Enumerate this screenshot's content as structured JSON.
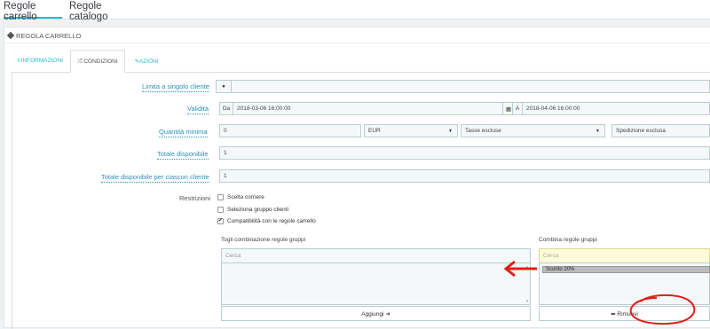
{
  "topnav": {
    "tab_cart_rules": "Regole carrello",
    "tab_catalog_rules": "Regole catalogo"
  },
  "panel": {
    "title": "REGOLA CARRELLO"
  },
  "tabs": {
    "info": "INFORMAZIONI",
    "conditions": "CONDIZIONI",
    "actions": "AZIONI"
  },
  "form": {
    "limit_customer_label": "Limita a singolo cliente",
    "validity_label": "Validità",
    "from_label": "Da",
    "from_value": "2018-03-06 16:00:00",
    "to_label": "A",
    "to_value": "2018-04-06 16:00:00",
    "min_qty_label": "Quantità minima",
    "min_qty_value": "0",
    "currency_value": "EUR",
    "tax_value": "Tasse escluse",
    "shipping_value": "Spedizione esclusa",
    "total_available_label": "Totale disponibile",
    "total_available_value": "1",
    "per_customer_label": "Totale disponibile per ciascun cliente",
    "per_customer_value": "1",
    "restrictions_label": "Restrizioni",
    "restriction_carrier": "Scelta corriere",
    "restriction_group": "Seleziona gruppo clienti",
    "restriction_compat": "Compatibilità con le regole carrello",
    "remove_combo_label": "Togli combinazione regole gruppi",
    "combine_label": "Combina regole gruppi",
    "search_placeholder": "Cerca",
    "search_value": "Cerca",
    "selected_option": "Sconto 20%",
    "add_button": "Aggiungi",
    "remove_button": "Rimuovi"
  },
  "colors": {
    "accent": "#25b9d7",
    "annotation": "#e0201a"
  }
}
